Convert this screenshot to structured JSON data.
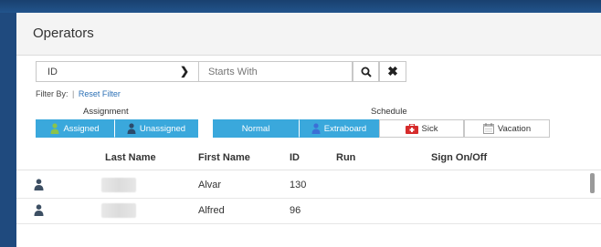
{
  "panel": {
    "title": "Operators"
  },
  "filter": {
    "field_value": "ID",
    "search_placeholder": "Starts With",
    "filter_by_label": "Filter By:",
    "separator": "|",
    "reset_label": "Reset Filter"
  },
  "assignment": {
    "label": "Assignment",
    "options": [
      {
        "label": "Assigned",
        "active": true
      },
      {
        "label": "Unassigned",
        "active": true
      }
    ]
  },
  "schedule": {
    "label": "Schedule",
    "options": [
      {
        "label": "Normal",
        "active": true
      },
      {
        "label": "Extraboard",
        "active": true
      },
      {
        "label": "Sick",
        "active": false
      },
      {
        "label": "Vacation",
        "active": false
      }
    ]
  },
  "table": {
    "columns": [
      "Last Name",
      "First Name",
      "ID",
      "Run",
      "Sign On/Off"
    ],
    "rows": [
      {
        "last_name": "",
        "first_name": "Alvar",
        "id": "130",
        "run": "",
        "sign": ""
      },
      {
        "last_name": "",
        "first_name": "Alfred",
        "id": "96",
        "run": "",
        "sign": ""
      }
    ]
  },
  "colors": {
    "accent": "#3aa8dc",
    "frame": "#1f4a7e",
    "link": "#2a6fb5",
    "sick_red": "#d62b2b",
    "assigned_green": "#8bc34a",
    "extraboard_blue": "#3b6fd6"
  },
  "icons": {
    "field_chevron": "chevron-down-icon",
    "search": "search-icon",
    "clear": "close-icon",
    "assigned": "person-icon",
    "unassigned": "person-icon",
    "extraboard": "person-icon",
    "sick": "first-aid-kit-icon",
    "vacation": "calendar-icon",
    "row": "user-icon"
  }
}
